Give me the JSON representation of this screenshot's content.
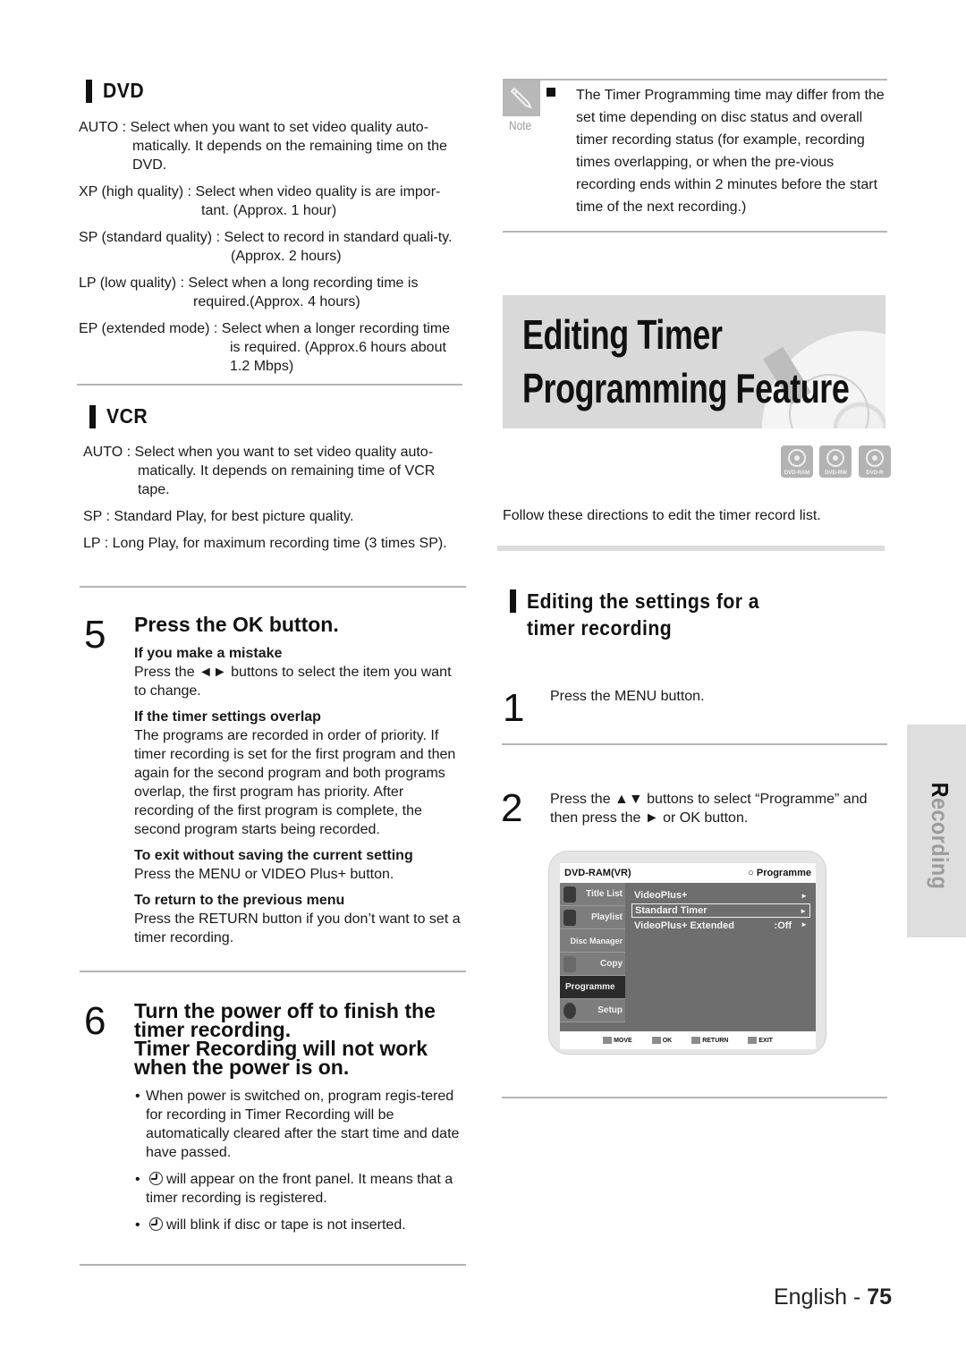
{
  "left": {
    "dvd": {
      "title": "DVD",
      "items": [
        {
          "term": "AUTO : ",
          "text": "Select when you want to set video quality auto-matically. It depends on the remaining time on the DVD."
        },
        {
          "term": "XP (high quality) : ",
          "text": "Select when video quality is are impor-tant. (Approx. 1 hour)"
        },
        {
          "term": "SP (standard quality) : ",
          "text": "Select to record in standard quali-ty. (Approx. 2 hours)"
        },
        {
          "term": "LP (low quality) : ",
          "text": "Select when a long recording time is required.(Approx. 4 hours)"
        },
        {
          "term": "EP (extended mode) : ",
          "text": "Select when a longer recording time is required. (Approx.6 hours about 1.2 Mbps)"
        }
      ]
    },
    "vcr": {
      "title": "VCR",
      "items": [
        {
          "term": "AUTO : ",
          "text": "Select when you want to set video quality auto-matically. It depends on remaining time of VCR tape."
        },
        {
          "term": "SP : ",
          "text": "Standard Play, for best picture quality."
        },
        {
          "term": "LP : ",
          "text": "Long Play, for maximum recording time (3 times SP)."
        }
      ]
    },
    "step5": {
      "number": "5",
      "title": "Press the OK button.",
      "subs": [
        {
          "heading": "If you make a mistake",
          "text": "Press the ◄► buttons to select the item you want to change."
        },
        {
          "heading": "If the timer settings overlap",
          "text": "The programs are recorded in order of priority. If timer recording is set for the first program and then again for the second program and both programs overlap, the first program has priority. After recording of the first program is complete, the second program starts being recorded."
        },
        {
          "heading": "To exit without saving the current setting",
          "text": "Press the MENU or VIDEO Plus+ button."
        },
        {
          "heading": "To return to the previous menu",
          "text": "Press the RETURN button if you don’t want to set a timer recording."
        }
      ]
    },
    "step6": {
      "number": "6",
      "title_lines": [
        "Turn the power off to finish the",
        "timer recording.",
        "Timer Recording will not work",
        "when the power is on."
      ],
      "bullets": [
        "When power is switched on, program regis-tered for recording in Timer Recording will be automatically cleared after the start time and date have passed.",
        "will appear on the front panel. It means that a timer recording is registered.",
        "will blink if disc or tape is not inserted."
      ]
    }
  },
  "right": {
    "note": {
      "label": "Note",
      "text": "The Timer Programming time may differ from the set time depending on disc status and overall timer recording status (for example, recording times overlapping, or when the pre-vious recording ends within 2 minutes before the start time of the next recording.)"
    },
    "banner": {
      "line1": "Editing Timer",
      "line2": "Programming Feature"
    },
    "disc_badges": [
      "DVD-RAM",
      "DVD-RW",
      "DVD-R"
    ],
    "intro": "Follow these directions to edit the timer record list.",
    "section_title": "Editing the settings for a timer recording",
    "step1": {
      "number": "1",
      "text": "Press the MENU button."
    },
    "step2": {
      "number": "2",
      "text": "Press the ▲▼ buttons to select “Programme” and then press the ► or OK button."
    },
    "osd": {
      "header_left": "DVD-RAM(VR)",
      "header_right": "○ Programme",
      "side_items": [
        "Title List",
        "Playlist",
        "Disc Manager",
        "Copy",
        "Programme",
        "Setup"
      ],
      "active_side": "Programme",
      "rows": [
        {
          "label": "VideoPlus+",
          "value": "",
          "arrow": "►"
        },
        {
          "label": "Standard Timer",
          "value": "",
          "arrow": "►",
          "selected": true
        },
        {
          "label": "VideoPlus+ Extended",
          "value": ":Off",
          "arrow": "►"
        }
      ],
      "footer": [
        "MOVE",
        "OK",
        "RETURN",
        "EXIT"
      ]
    }
  },
  "side_tab": {
    "first": "R",
    "rest": "ecording"
  },
  "footer": {
    "lang": "English",
    "sep": " - ",
    "page": "75"
  }
}
